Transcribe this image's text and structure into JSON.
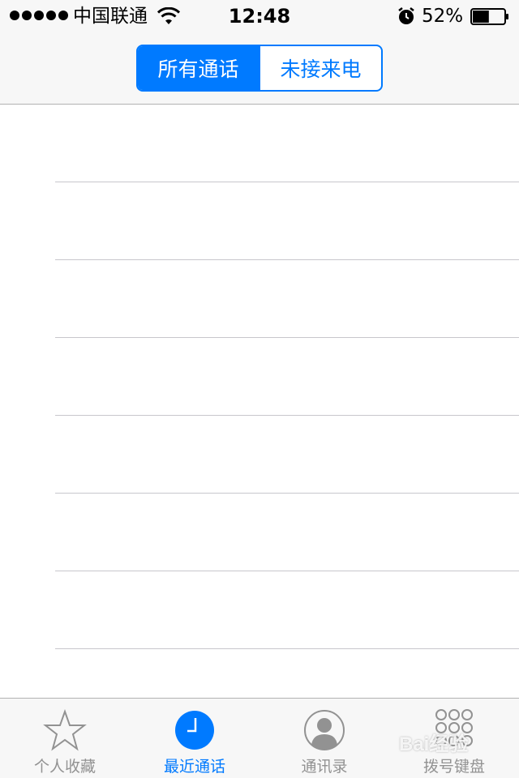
{
  "status_bar": {
    "carrier": "中国联通",
    "time": "12:48",
    "battery_percent": "52%",
    "battery_level": 0.52,
    "signal_bars": 5
  },
  "segmented_control": {
    "options": [
      "所有通话",
      "未接来电"
    ],
    "selected_index": 0
  },
  "call_list": {
    "rows": 8
  },
  "tab_bar": {
    "items": [
      {
        "label": "个人收藏",
        "icon": "star-icon",
        "active": false
      },
      {
        "label": "最近通话",
        "icon": "clock-icon",
        "active": true
      },
      {
        "label": "通讯录",
        "icon": "contact-icon",
        "active": false
      },
      {
        "label": "拨号键盘",
        "icon": "keypad-icon",
        "active": false
      }
    ]
  },
  "watermark": {
    "text": "Bai经验"
  },
  "colors": {
    "accent": "#007aff",
    "bar_background": "#f7f7f7",
    "inactive_tab": "#929292",
    "separator": "#c8c7cc"
  }
}
